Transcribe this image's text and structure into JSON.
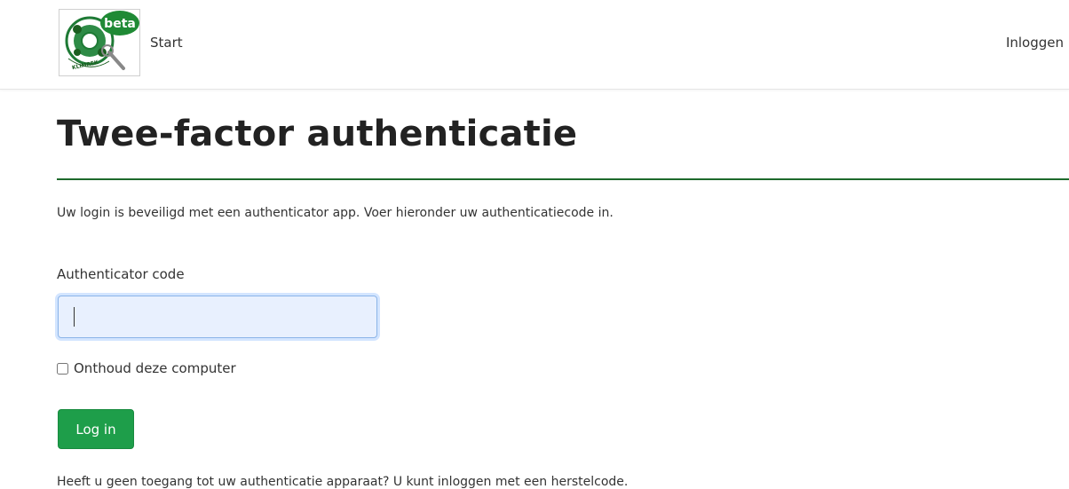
{
  "header": {
    "logo_badge": "beta",
    "logo_text": "KLIMREK",
    "start_label": "Start",
    "login_label": "Inloggen"
  },
  "main": {
    "title": "Twee-factor authenticatie",
    "intro": "Uw login is beveiligd met een authenticator app. Voer hieronder uw authenticatiecode in.",
    "code_label": "Authenticator code",
    "code_value": "",
    "remember_label": "Onthoud deze computer",
    "remember_checked": false,
    "submit_label": "Log in",
    "recovery_prefix": "Heeft u geen toegang tot uw authenticatie apparaat? U kunt ",
    "recovery_link": "inloggen met een herstelcode",
    "recovery_suffix": "."
  },
  "colors": {
    "accent_green": "#1e9e4a",
    "rule_green": "#1e6a2c",
    "input_focus_bg": "#e8f0fe"
  },
  "icons": [
    "klimrek-logo",
    "magnifier-icon"
  ]
}
